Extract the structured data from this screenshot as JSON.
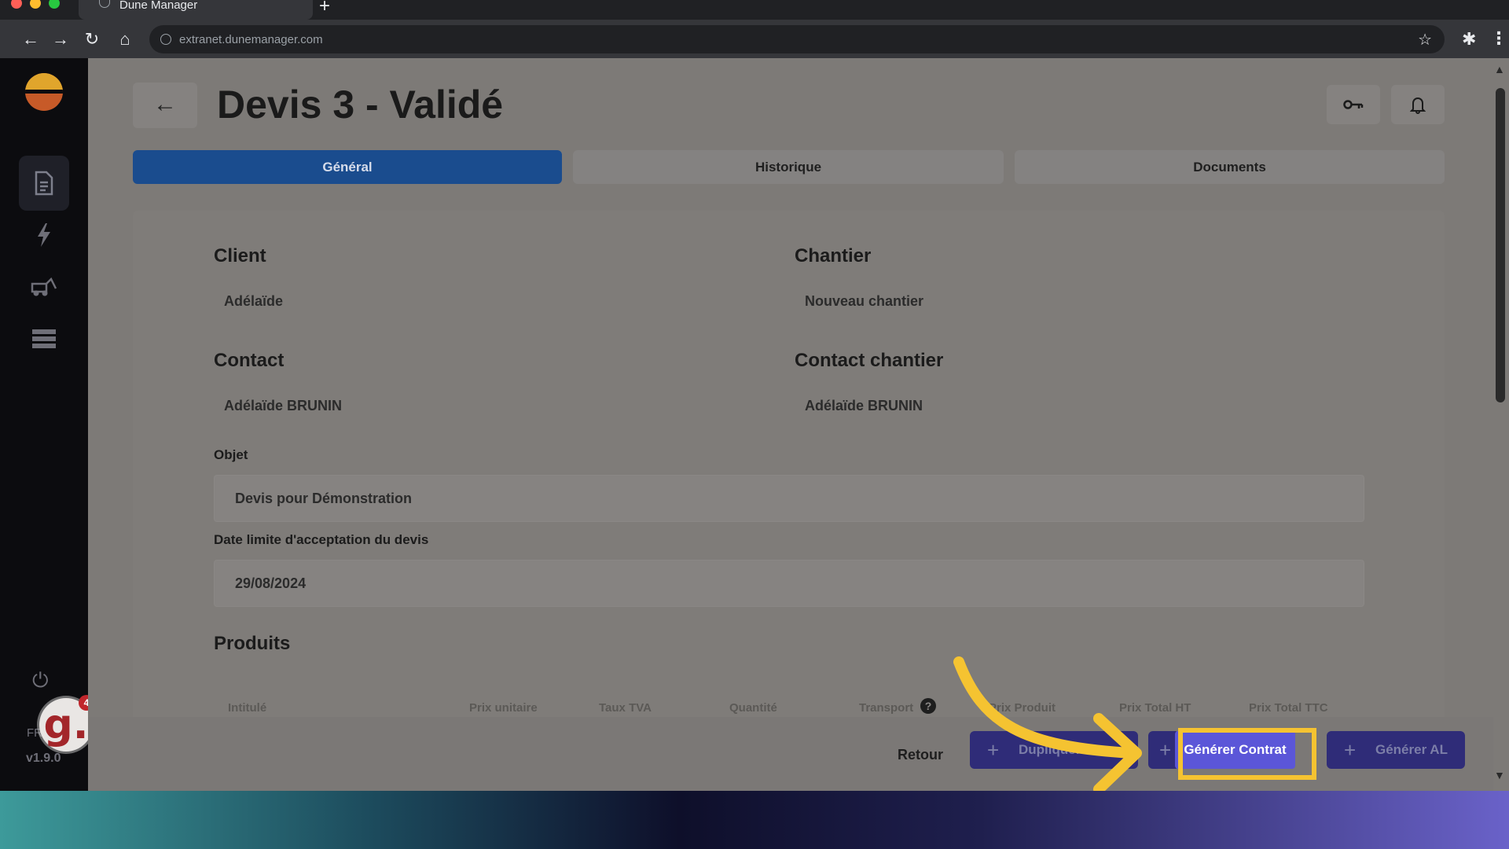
{
  "browser": {
    "tab_title": "Dune Manager",
    "new_tab": "+",
    "url": "extranet.dunemanager.com"
  },
  "sidebar": {
    "lang": "FR",
    "version": "v1.9.0",
    "notif_count": "4",
    "avatar_letter": "g."
  },
  "header": {
    "title": "Devis 3 - Validé"
  },
  "tabs": [
    {
      "label": "Général",
      "active": true
    },
    {
      "label": "Historique",
      "active": false
    },
    {
      "label": "Documents",
      "active": false
    }
  ],
  "form": {
    "client_label": "Client",
    "client_value": "Adélaïde",
    "chantier_label": "Chantier",
    "chantier_value": "Nouveau chantier",
    "contact_label": "Contact",
    "contact_value": "Adélaïde BRUNIN",
    "contact_chantier_label": "Contact chantier",
    "contact_chantier_value": "Adélaïde BRUNIN",
    "objet_label": "Objet",
    "objet_value": "Devis pour Démonstration",
    "date_label": "Date limite d'acceptation du devis",
    "date_value": "29/08/2024",
    "produits_label": "Produits"
  },
  "table": {
    "headers": [
      "Intitulé",
      "Prix unitaire",
      "Taux TVA",
      "Quantité",
      "Transport",
      "Prix Produit",
      "Prix Total HT",
      "Prix Total TTC"
    ]
  },
  "footer": {
    "retour": "Retour",
    "dupliquer": "Dupliquer",
    "generer_contrat": "Générer Contrat",
    "generer_al": "Générer AL",
    "plus": "+"
  },
  "colors": {
    "primary_tab": "#1a4c8e",
    "button": "#2f2c78",
    "highlight_button": "#5b56d8",
    "highlight_box": "#f5c331"
  }
}
